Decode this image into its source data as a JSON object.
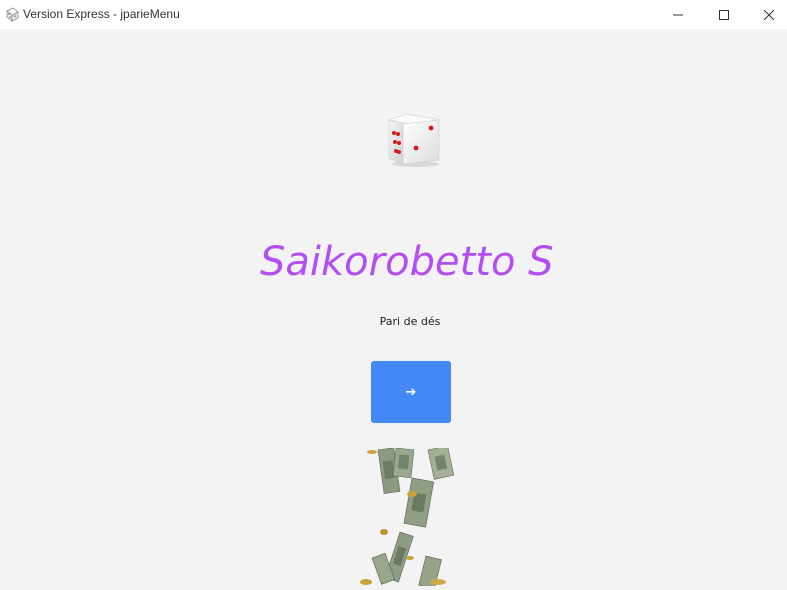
{
  "window": {
    "title": "Version Express - jparieMenu",
    "app_icon": "dice-icon",
    "controls": [
      "minimize-icon",
      "maximize-icon",
      "close-icon"
    ]
  },
  "main": {
    "logo_icon": "dice-icon",
    "headline": "Saikorobetto S",
    "subtitle": "Pari de dés",
    "start_button_label": "➔",
    "animation": "money-rain-animation"
  },
  "colors": {
    "headline": "#b34ef4",
    "button": "#4388f4",
    "background": "#f3f3f3",
    "titlebar": "#ffffff"
  }
}
